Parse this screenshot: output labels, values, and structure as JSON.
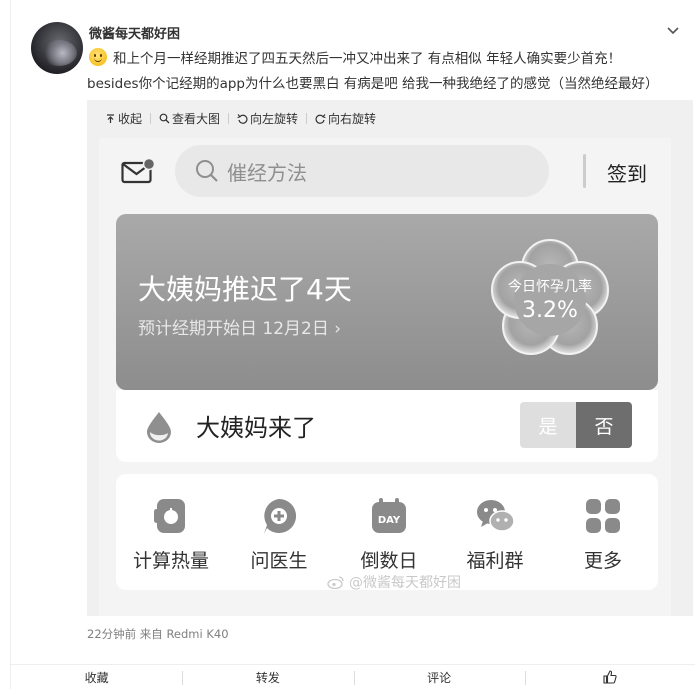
{
  "post": {
    "username": "微酱每天都好困",
    "text_line1": "和上个月一样经期推迟了四五天然后一冲又冲出来了 有点相似 年轻人确实要少首充！",
    "text_line2": "besides你个记经期的app为什么也要黑白 有病是吧 给我一种我绝经了的感觉（当然绝经最好）",
    "meta": "22分钟前  来自 Redmi K40"
  },
  "media_toolbar": {
    "collapse": "收起",
    "view_large": "查看大图",
    "rotate_left": "向左旋转",
    "rotate_right": "向右旋转"
  },
  "app": {
    "search_placeholder": "催经方法",
    "signin": "签到",
    "banner": {
      "title": "大姨妈推迟了4天",
      "subtitle": "预计经期开始日 12月2日 ›",
      "prob_label": "今日怀孕几率",
      "prob_value": "3.2%"
    },
    "period": {
      "label": "大姨妈来了",
      "yes": "是",
      "no": "否",
      "selected": "否"
    },
    "quick_items": [
      {
        "label": "计算热量",
        "icon": "calculator-icon"
      },
      {
        "label": "问医生",
        "icon": "doctor-plus-icon"
      },
      {
        "label": "倒数日",
        "icon": "day-calendar-icon"
      },
      {
        "label": "福利群",
        "icon": "wechat-bubbles-icon"
      },
      {
        "label": "更多",
        "icon": "grid-more-icon"
      }
    ],
    "calendar_icon_text": "DAY",
    "watermark": "@微酱每天都好困"
  },
  "actions": {
    "favorite": "收藏",
    "repost": "转发",
    "comment": "评论"
  },
  "colors": {
    "banner": "#9a9a9a",
    "toggle_selected": "#6e6e6e",
    "emoji": "#f6b500"
  }
}
